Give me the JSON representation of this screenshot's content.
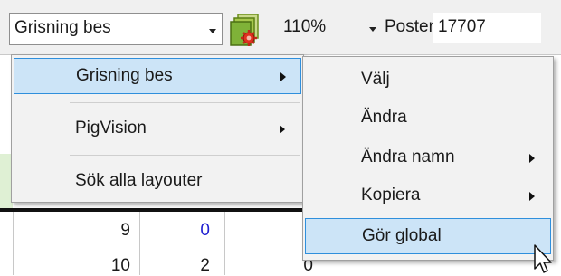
{
  "toolbar": {
    "layout_select_value": "Grisning bes",
    "zoom_value": "110%",
    "posts_label": "Poster",
    "posts_count": "17707"
  },
  "grid": {
    "row1": [
      "9",
      "0"
    ],
    "row2": [
      "10",
      "2",
      "0"
    ],
    "colors": {
      "accent": "#1f1fd1",
      "default": "#1a1a1a"
    }
  },
  "main_menu": {
    "items": [
      {
        "label": "Grisning bes",
        "has_submenu": true,
        "highlighted": true
      },
      {
        "label": "PigVision",
        "has_submenu": true,
        "highlighted": false
      },
      {
        "label": "Sök alla layouter",
        "has_submenu": false,
        "highlighted": false
      }
    ]
  },
  "sub_menu": {
    "items": [
      {
        "label": "Välj",
        "has_submenu": false
      },
      {
        "label": "Ändra",
        "has_submenu": false
      },
      {
        "label": "Ändra namn",
        "has_submenu": true
      },
      {
        "label": "Kopiera",
        "has_submenu": true
      },
      {
        "label": "Gör global",
        "has_submenu": false,
        "highlighted": true
      }
    ]
  },
  "colors": {
    "menu_bg": "#f2f2f2",
    "highlight_bg": "#cce4f7",
    "highlight_border": "#2f8fdc",
    "toolbar_bg": "#f0f0f0"
  },
  "icons": {
    "layout_tool": "layout-settings-icon",
    "cursor": "mouse-pointer-icon"
  }
}
